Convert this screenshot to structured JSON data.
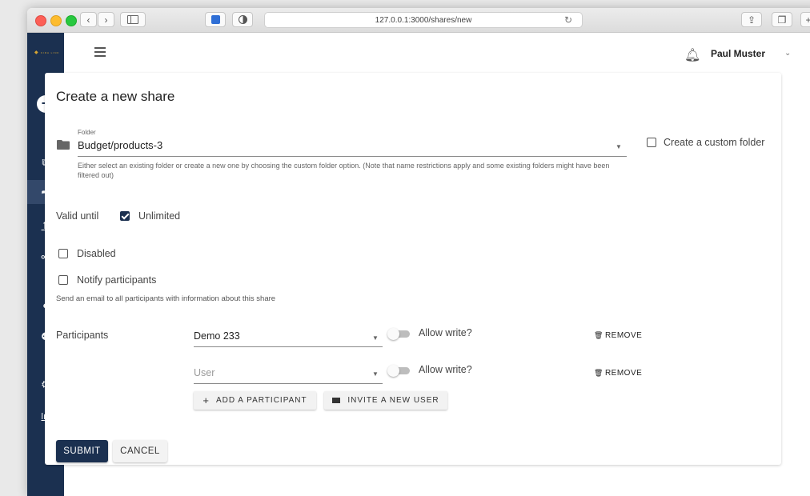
{
  "browser": {
    "url": "127.0.0.1:3000/shares/new"
  },
  "sidebar": {
    "logo_text": "KIRA LINK",
    "items": [
      {
        "icon": "add-circle-icon"
      },
      {
        "icon": "copy-icon"
      },
      {
        "icon": "share-icon",
        "active": true
      },
      {
        "icon": "upload-icon"
      },
      {
        "icon": "link-icon"
      },
      {
        "icon": "user-icon"
      },
      {
        "icon": "users-icon"
      },
      {
        "icon": "gear-icon"
      },
      {
        "icon": "chart-icon"
      }
    ]
  },
  "header": {
    "user_name": "Paul Muster"
  },
  "form": {
    "title": "Create a new share",
    "folder": {
      "label": "Folder",
      "value": "Budget/products-3",
      "hint": "Either select an existing folder or create a new one by choosing the custom folder option. (Note that name restrictions apply and some existing folders might have been filtered out)",
      "custom_folder_label": "Create a custom folder",
      "custom_folder_checked": false
    },
    "valid_until": {
      "label": "Valid until",
      "unlimited_label": "Unlimited",
      "unlimited_checked": true
    },
    "disabled_label": "Disabled",
    "disabled_checked": false,
    "notify_label": "Notify participants",
    "notify_checked": false,
    "notify_hint": "Send an email to all participants with information about this share",
    "participants": {
      "label": "Participants",
      "rows": [
        {
          "value": "Demo 233",
          "placeholder": "",
          "allow_write_label": "Allow write?",
          "allow_write": false,
          "remove_label": "REMOVE"
        },
        {
          "value": "",
          "placeholder": "User",
          "allow_write_label": "Allow write?",
          "allow_write": false,
          "remove_label": "REMOVE"
        }
      ],
      "add_label": "ADD A PARTICIPANT",
      "invite_label": "INVITE A NEW USER"
    },
    "submit_label": "SUBMIT",
    "cancel_label": "CANCEL"
  },
  "colors": {
    "sidebar": "#1b3050",
    "primary": "#1b3050"
  }
}
